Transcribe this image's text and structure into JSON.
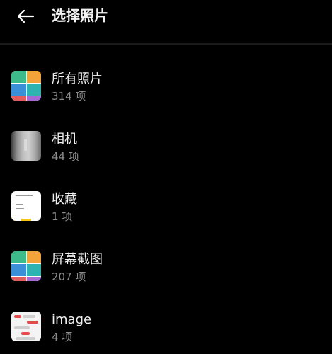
{
  "header": {
    "back_icon": "arrow-left-icon",
    "title": "选择照片"
  },
  "albums": [
    {
      "name": "所有照片",
      "count": "314 项",
      "thumb": "colorful-app-tiles"
    },
    {
      "name": "相机",
      "count": "44 项",
      "thumb": "camera-photo"
    },
    {
      "name": "收藏",
      "count": "1 项",
      "thumb": "document-screenshot"
    },
    {
      "name": "屏幕截图",
      "count": "207 项",
      "thumb": "colorful-app-tiles"
    },
    {
      "name": "image",
      "count": "4 项",
      "thumb": "chat-screenshot"
    }
  ],
  "colors": {
    "background": "#000000",
    "text_primary": "#f0f0f0",
    "text_secondary": "#8a8a8a",
    "tile_green": "#3dbb8a",
    "tile_orange": "#f2a33a",
    "tile_blue": "#3a8fd6",
    "tile_teal": "#2fb3b0",
    "tile_red": "#e35d5d",
    "tile_purple": "#a36ad6"
  }
}
